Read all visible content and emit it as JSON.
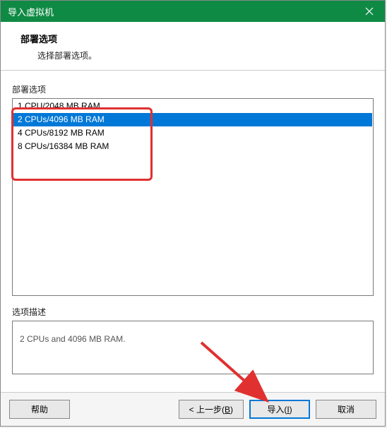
{
  "window": {
    "title": "导入虚拟机"
  },
  "header": {
    "title": "部署选项",
    "subtitle": "选择部署选项。"
  },
  "options": {
    "group_label": "部署选项",
    "items": [
      "1 CPU/2048 MB RAM",
      "2 CPUs/4096 MB RAM",
      "4 CPUs/8192 MB RAM",
      "8 CPUs/16384 MB RAM"
    ],
    "selected_index": 1
  },
  "description": {
    "group_label": "选项描述",
    "text": "2 CPUs and 4096 MB RAM."
  },
  "footer": {
    "help_label": "帮助",
    "back_prefix": "< 上一步(",
    "back_key": "B",
    "back_suffix": ")",
    "import_prefix": "导入(",
    "import_key": "I",
    "import_suffix": ")",
    "cancel_label": "取消"
  }
}
